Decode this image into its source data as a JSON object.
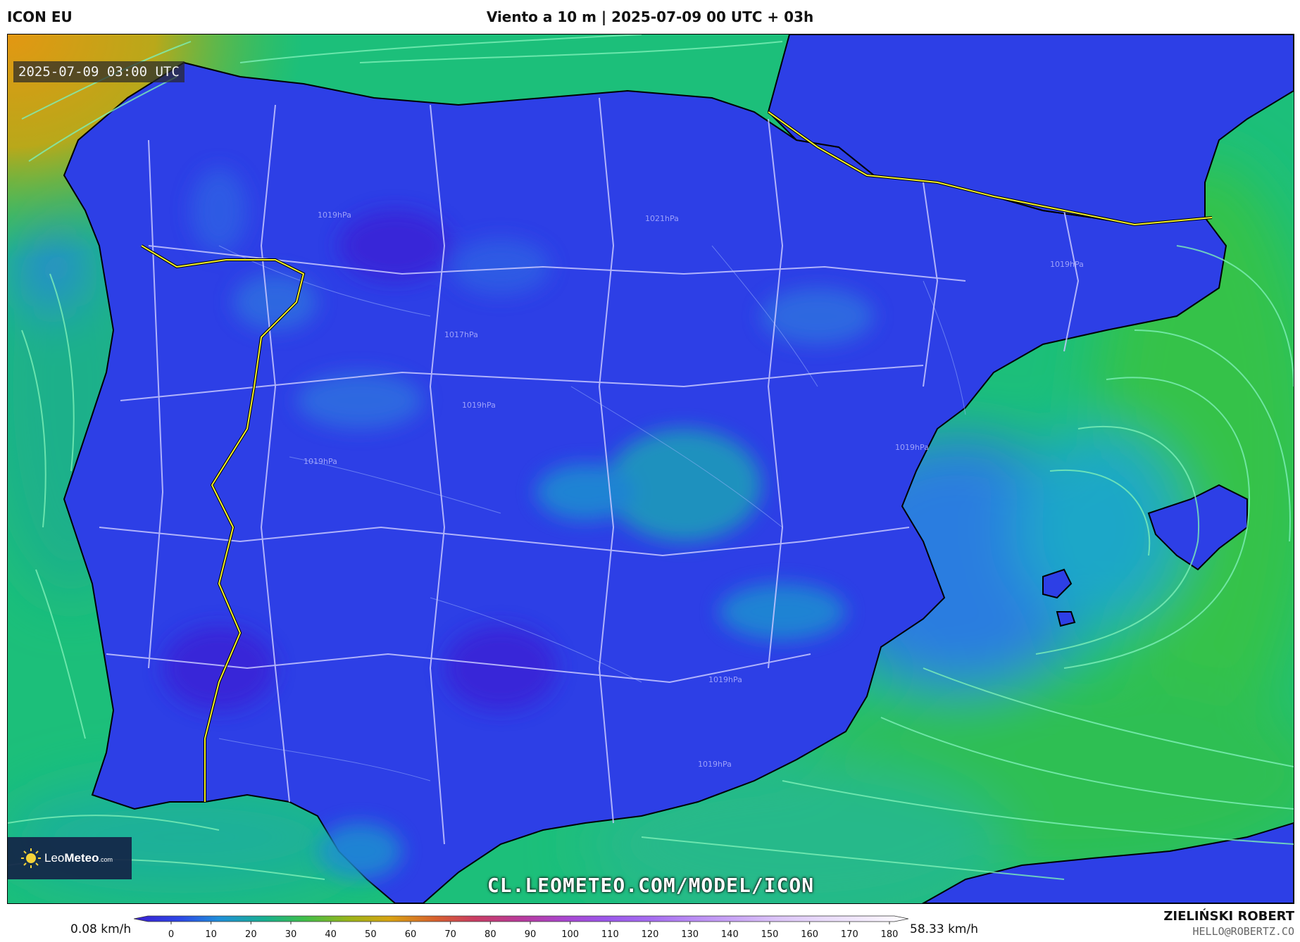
{
  "header": {
    "model": "ICON EU",
    "title": "Viento a 10 m | 2025-07-09 00 UTC + 03h"
  },
  "map": {
    "valid_time": "2025-07-09 03:00 UTC",
    "watermark": "CL.LEOMETEO.COM/MODEL/ICON",
    "logo": {
      "name_light": "Leo",
      "name_bold": "Meteo",
      "suffix": ".com"
    },
    "isobar_labels": [
      "1019hPa",
      "1021hPa",
      "1017hPa",
      "1019hPa",
      "1019hPa",
      "1019hPa",
      "1019hPa",
      "1019hPa",
      "1019hPa"
    ]
  },
  "legend": {
    "min_label": "0.08 km/h",
    "max_label": "58.33 km/h",
    "ticks": [
      "0",
      "10",
      "20",
      "30",
      "40",
      "50",
      "60",
      "70",
      "80",
      "90",
      "100",
      "110",
      "120",
      "130",
      "140",
      "150",
      "160",
      "170",
      "180"
    ],
    "stops": [
      "#3a1fd1",
      "#2d47e6",
      "#1f8fd9",
      "#18b08f",
      "#3fbf4a",
      "#9db418",
      "#d8a312",
      "#d8602e",
      "#c93c62",
      "#b83a9c",
      "#a847d2",
      "#9b57ea",
      "#a66ef0",
      "#b98bf4",
      "#cba8f6",
      "#dcc4f8",
      "#e9dbfa",
      "#f4ecfc",
      "#ffffff"
    ]
  },
  "credits": {
    "author": "ZIELIŃSKI ROBERT",
    "email": "HELLO@ROBERTZ.CO"
  }
}
